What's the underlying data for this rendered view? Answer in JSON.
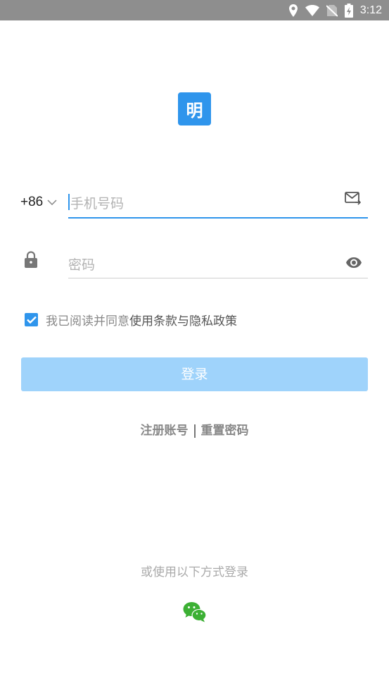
{
  "status_bar": {
    "time": "3:12"
  },
  "logo": {
    "text": "明"
  },
  "phone": {
    "country_code": "+86",
    "placeholder": "手机号码"
  },
  "password": {
    "placeholder": "密码"
  },
  "agreement": {
    "prefix": "我已阅读并同意",
    "link": "使用条款与隐私政策",
    "checked": true
  },
  "login_button": {
    "label": "登录"
  },
  "links": {
    "register": "注册账号",
    "reset": "重置密码"
  },
  "alternate_login": {
    "label": "或使用以下方式登录",
    "icon": "wechat-icon"
  },
  "colors": {
    "accent": "#2f95ec",
    "button_disabled": "#9fd3fb",
    "status_bar": "#8e8e8e",
    "wechat": "#3cb034"
  }
}
